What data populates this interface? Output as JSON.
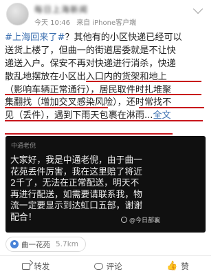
{
  "header": {
    "username": "每日上海新闻",
    "time": "今天 10:46",
    "source": "来自 iPhone客户端"
  },
  "post": {
    "lines": [
      {
        "hashtag": "#上海回来了#",
        "text": "？其他有的小区快递已经可以"
      },
      {
        "text": "送货上楼了，但曲一的街道居委就是不让快"
      },
      {
        "text": "递送入户。保安不再对快递进行消杀，快递"
      },
      {
        "text": "散乱地摆放在小区出入口内的货架和地上"
      },
      {
        "text": "（影响车辆正常通行），居民取件时扎堆聚"
      },
      {
        "text": "集翻找（增加交叉感染风险），还时常找不"
      },
      {
        "text": "见（丢件），遇到下雨天包裹在淋雨...",
        "more": "全文"
      }
    ]
  },
  "media": {
    "source_label": "中通老倪",
    "lines": [
      "大家好，我是中通老倪，由于曲一",
      "花苑丢件厉害，我在这里赔了将近",
      "2千了，无法在正常配送，明天不",
      "再进行配送，如需要请联系我，物",
      "流一定要显示到达虹口五部，谢谢",
      "配合！"
    ],
    "watermark": "@今日郝襄"
  },
  "location": {
    "name": "曲一花苑",
    "distance": "5.7km"
  },
  "actions": {
    "share": "转发",
    "comment": "评论",
    "like": "赞"
  }
}
